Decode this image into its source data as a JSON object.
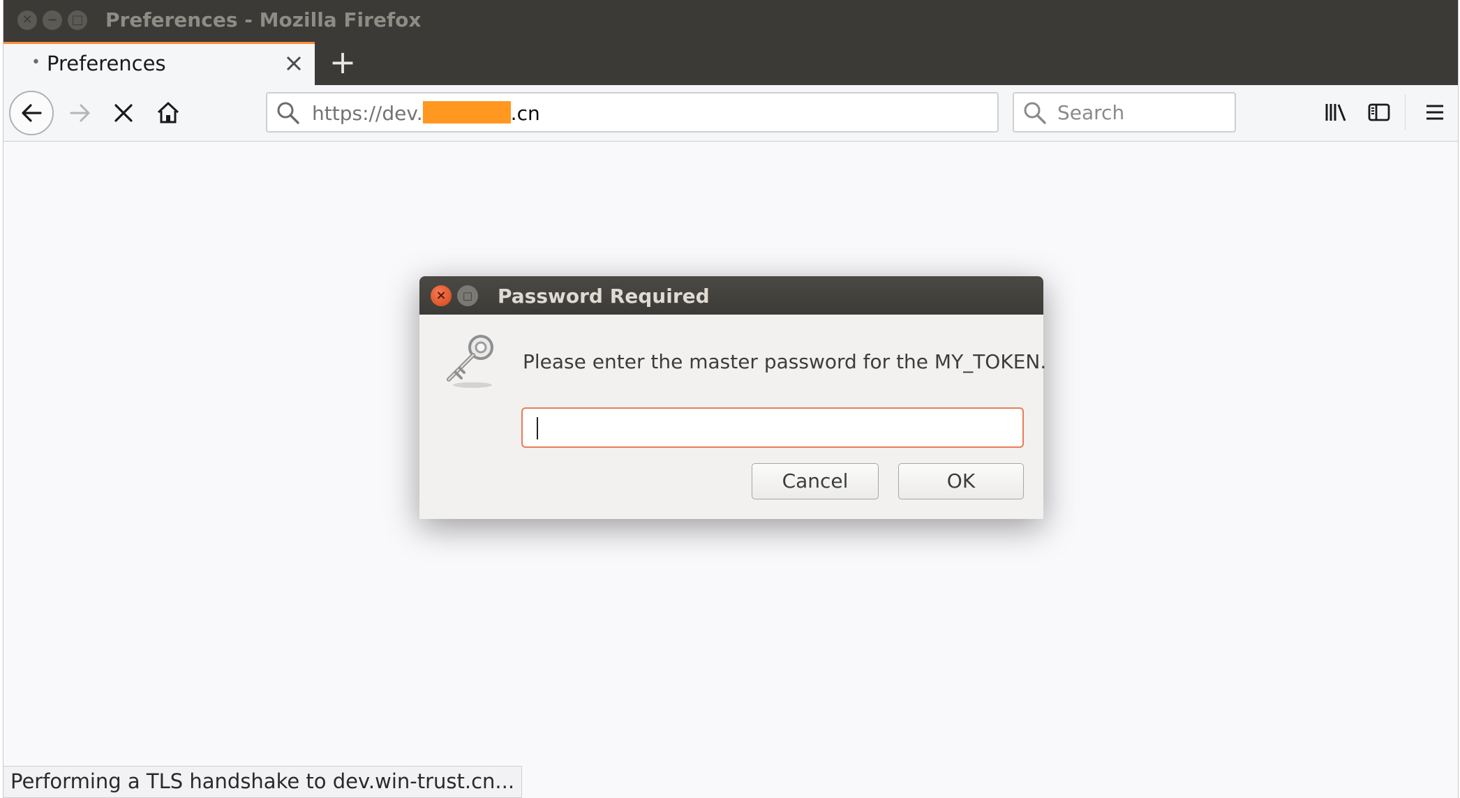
{
  "window": {
    "title": "Preferences - Mozilla Firefox"
  },
  "tabs": [
    {
      "label": "Preferences",
      "active": true,
      "loading_indicator": "•"
    }
  ],
  "toolbar": {
    "new_tab_symbol": "+",
    "url": {
      "scheme_host_prefix": "https://dev.",
      "redacted": true,
      "suffix": ".cn"
    },
    "search_placeholder": "Search"
  },
  "dialog": {
    "title": "Password Required",
    "message": "Please enter the master password for the MY_TOKEN.",
    "password_value": "",
    "cancel_label": "Cancel",
    "ok_label": "OK"
  },
  "status": {
    "text": "Performing a TLS handshake to dev.win-trust.cn..."
  },
  "icons": {
    "tab_close": "close-icon",
    "back": "back-arrow-icon",
    "forward": "forward-arrow-icon",
    "stop": "stop-icon",
    "home": "home-icon",
    "url_search": "search-icon",
    "library": "library-icon",
    "sidebar": "sidebar-icon",
    "menu": "hamburger-menu-icon",
    "dialog_key": "key-icon"
  },
  "colors": {
    "titlebar": "#3b3a36",
    "tab_accent": "#ff8c3a",
    "redaction": "#ff9721",
    "dialog_close": "#d9441a",
    "input_focus_border": "#e87c56"
  }
}
